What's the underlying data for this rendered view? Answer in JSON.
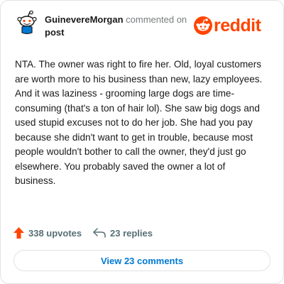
{
  "header": {
    "username": "GuinevereMorgan",
    "action": "commented on",
    "target": "post",
    "avatar_icon": "reddit-snoo-avatar-icon",
    "brand": "reddit",
    "brand_icon": "reddit-logo-icon"
  },
  "comment": {
    "text": "NTA. The owner was right to fire her. Old, loyal customers are worth more to his business than new, lazy employees. And it was laziness - grooming large dogs are time-consuming (that's a ton of hair lol). She saw big dogs and used stupid excuses not to do her job. She had you pay because she didn't want to get in trouble, because most people wouldn't bother to call the owner, they'd just go elsewhere. You probably saved the owner a lot of business."
  },
  "footer": {
    "upvotes": "338 upvotes",
    "upvote_icon": "upvote-arrow-icon",
    "replies": "23 replies",
    "reply_icon": "reply-arrow-icon",
    "view_comments": "View 23 comments"
  },
  "colors": {
    "accent": "#ff4500",
    "link": "#0079d3",
    "muted": "#787c7e"
  }
}
